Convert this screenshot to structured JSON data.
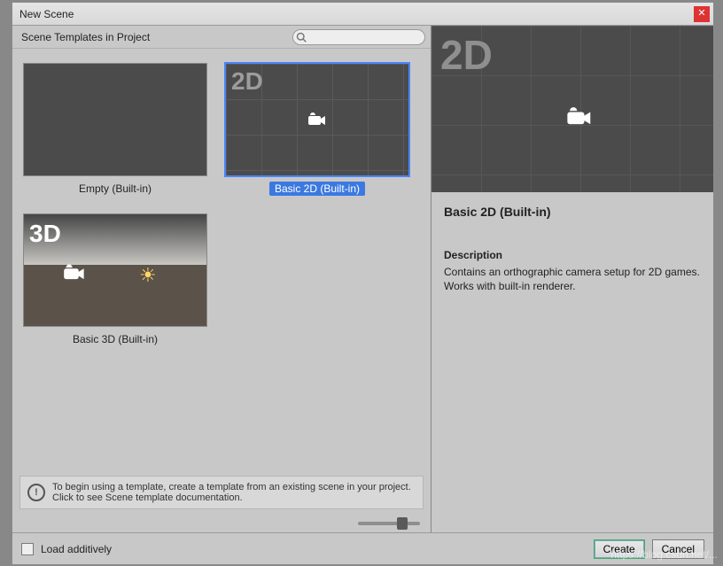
{
  "dialog": {
    "title": "New Scene"
  },
  "left": {
    "header_label": "Scene Templates in Project",
    "search_placeholder": ""
  },
  "templates": [
    {
      "id": "empty",
      "name": "Empty (Built-in)",
      "kind": "empty",
      "selected": false
    },
    {
      "id": "basic2d",
      "name": "Basic 2D (Built-in)",
      "kind": "2d",
      "selected": true
    },
    {
      "id": "basic3d",
      "name": "Basic 3D (Built-in)",
      "kind": "3d",
      "selected": false
    }
  ],
  "info_banner": {
    "line1": "To begin using a template, create a template from an existing scene in your project.",
    "line2": "Click to see Scene template documentation."
  },
  "zoom": {
    "value": 0.63
  },
  "preview": {
    "title": "Basic 2D (Built-in)",
    "description_heading": "Description",
    "description_text": "Contains an orthographic camera setup for 2D games. Works with built-in renderer."
  },
  "footer": {
    "load_additively_label": "Load additively",
    "load_additively_checked": false,
    "create_label": "Create",
    "cancel_label": "Cancel"
  },
  "watermark": "https://blog.csdn.net/..."
}
